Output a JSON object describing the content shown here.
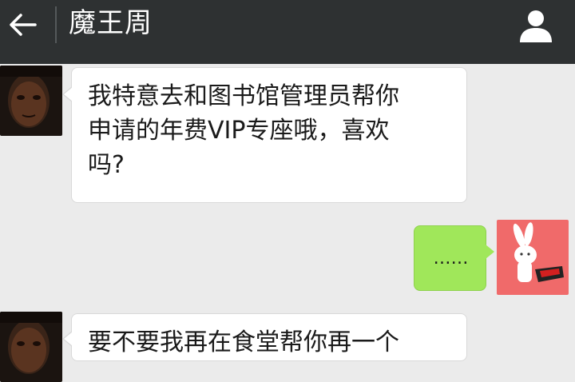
{
  "header": {
    "title": "魔王周",
    "back_icon": "arrow-left-icon",
    "profile_icon": "person-icon",
    "background": "#2e3132"
  },
  "messages": [
    {
      "side": "left",
      "text": "我特意去和图书馆管理员帮你\n申请的年费VIP专座哦，喜欢\n吗?",
      "avatar": "contact-avatar-photo",
      "bubble_color": "#ffffff"
    },
    {
      "side": "right",
      "text": "……",
      "avatar": "user-avatar-rabbit",
      "bubble_color": "#a0e75a"
    },
    {
      "side": "left",
      "text": "要不要我再在食堂帮你再一个",
      "avatar": "contact-avatar-photo",
      "bubble_color": "#ffffff"
    }
  ]
}
